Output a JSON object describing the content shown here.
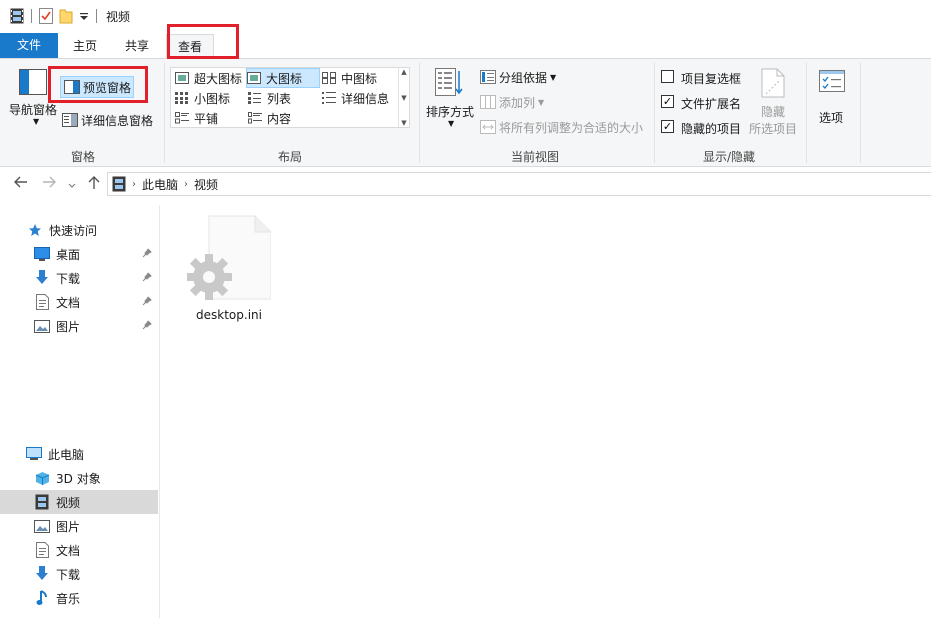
{
  "window": {
    "title": "视频"
  },
  "tabs": {
    "file": "文件",
    "home": "主页",
    "share": "共享",
    "view": "查看"
  },
  "ribbon": {
    "panes": {
      "nav_pane": "导航窗格",
      "preview_pane": "预览窗格",
      "details_pane": "详细信息窗格",
      "group_label": "窗格"
    },
    "layout": {
      "extra_large": "超大图标",
      "large": "大图标",
      "medium": "中图标",
      "small": "小图标",
      "list": "列表",
      "details": "详细信息",
      "tiles": "平铺",
      "content": "内容",
      "group_label": "布局",
      "selected": "大图标"
    },
    "current_view": {
      "sort_by": "排序方式",
      "group_by": "分组依据",
      "add_columns": "添加列",
      "size_all_columns": "将所有列调整为合适的大小",
      "group_label": "当前视图"
    },
    "show_hide": {
      "item_checkboxes": "项目复选框",
      "item_checkboxes_checked": false,
      "file_extensions": "文件扩展名",
      "file_extensions_checked": true,
      "hidden_items": "隐藏的项目",
      "hidden_items_checked": true,
      "hide_selected_line1": "隐藏",
      "hide_selected_line2": "所选项目",
      "group_label": "显示/隐藏"
    },
    "options": "选项"
  },
  "address": {
    "segments": [
      "此电脑",
      "视频"
    ]
  },
  "nav": {
    "quick_access": "快速访问",
    "quick_items": [
      "桌面",
      "下载",
      "文档",
      "图片"
    ],
    "this_pc": "此电脑",
    "pc_items": [
      "3D 对象",
      "视频",
      "图片",
      "文档",
      "下载",
      "音乐"
    ],
    "selected": "视频"
  },
  "files": [
    {
      "name": "desktop.ini"
    }
  ],
  "colors": {
    "accent": "#1979ca",
    "highlight": "#e2202b",
    "selection": "#cce8ff"
  }
}
